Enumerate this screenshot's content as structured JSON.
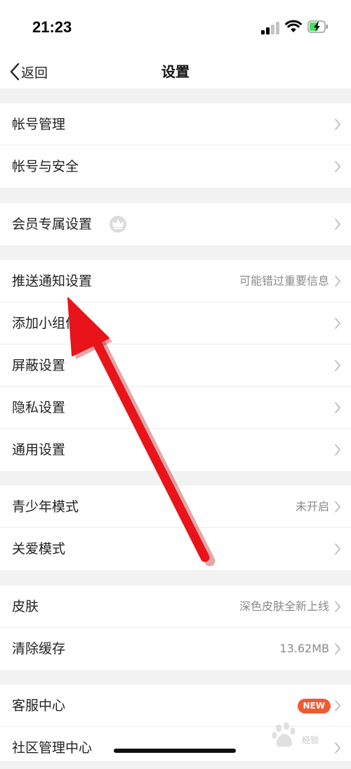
{
  "status_bar": {
    "time": "21:23"
  },
  "nav": {
    "back_label": "返回",
    "title": "设置"
  },
  "groups": [
    {
      "items": [
        {
          "label": "帐号管理"
        },
        {
          "label": "帐号与安全"
        }
      ]
    },
    {
      "items": [
        {
          "label": "会员专属设置",
          "icon": "crown-icon"
        }
      ]
    },
    {
      "items": [
        {
          "label": "推送通知设置",
          "value": "可能错过重要信息"
        },
        {
          "label": "添加小组件"
        },
        {
          "label": "屏蔽设置"
        },
        {
          "label": "隐私设置"
        },
        {
          "label": "通用设置"
        }
      ]
    },
    {
      "items": [
        {
          "label": "青少年模式",
          "value": "未开启"
        },
        {
          "label": "关爱模式"
        }
      ]
    },
    {
      "items": [
        {
          "label": "皮肤",
          "value": "深色皮肤全新上线"
        },
        {
          "label": "清除缓存",
          "value": "13.62MB"
        }
      ]
    },
    {
      "items": [
        {
          "label": "客服中心",
          "badge": "NEW"
        },
        {
          "label": "社区管理中心"
        }
      ]
    }
  ],
  "colors": {
    "badge": "#f05a33",
    "annotation_arrow": "#e8141a",
    "battery_charging": "#4cd964"
  },
  "watermark": {
    "text": "经验"
  }
}
